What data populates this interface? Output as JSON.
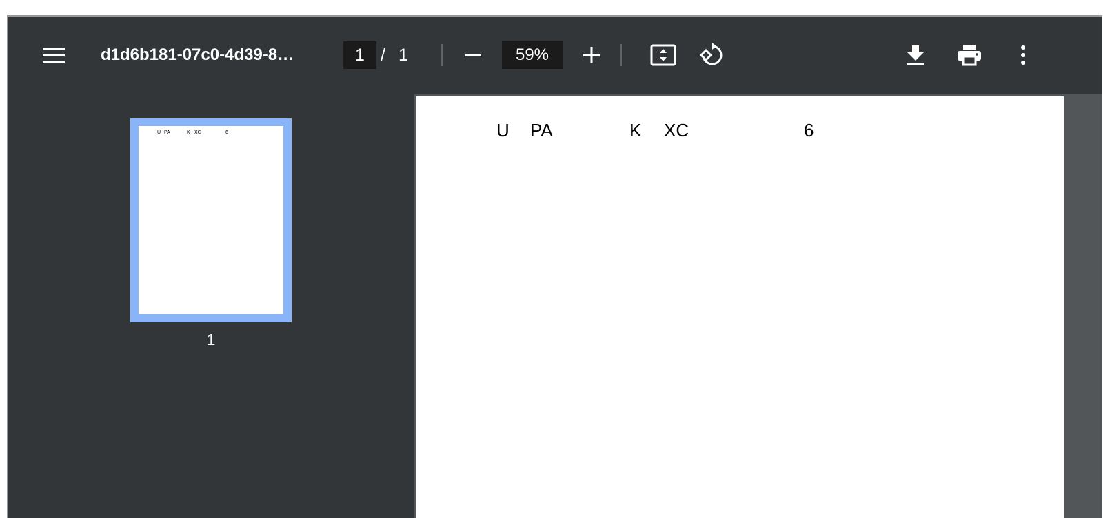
{
  "toolbar": {
    "title": "d1d6b181-07c0-4d39-8…",
    "page_current": "1",
    "page_separator": "/",
    "page_total": "1",
    "zoom": "59%",
    "icons": {
      "menu": "menu-icon",
      "zoom_out": "minus-icon",
      "zoom_in": "plus-icon",
      "fit": "fit-to-page-icon",
      "rotate": "rotate-icon",
      "download": "download-icon",
      "print": "print-icon",
      "more": "more-vert-icon"
    }
  },
  "sidebar": {
    "thumbnails": [
      {
        "label": "1",
        "text": [
          "U",
          "PA",
          "K",
          "XC",
          "6"
        ]
      }
    ]
  },
  "document": {
    "page_text": [
      "U",
      "PA",
      "K",
      "XC",
      "6"
    ]
  },
  "colors": {
    "toolbar_bg": "#323639",
    "thumb_highlight": "#8ab4f8",
    "page_bg": "#ffffff"
  }
}
